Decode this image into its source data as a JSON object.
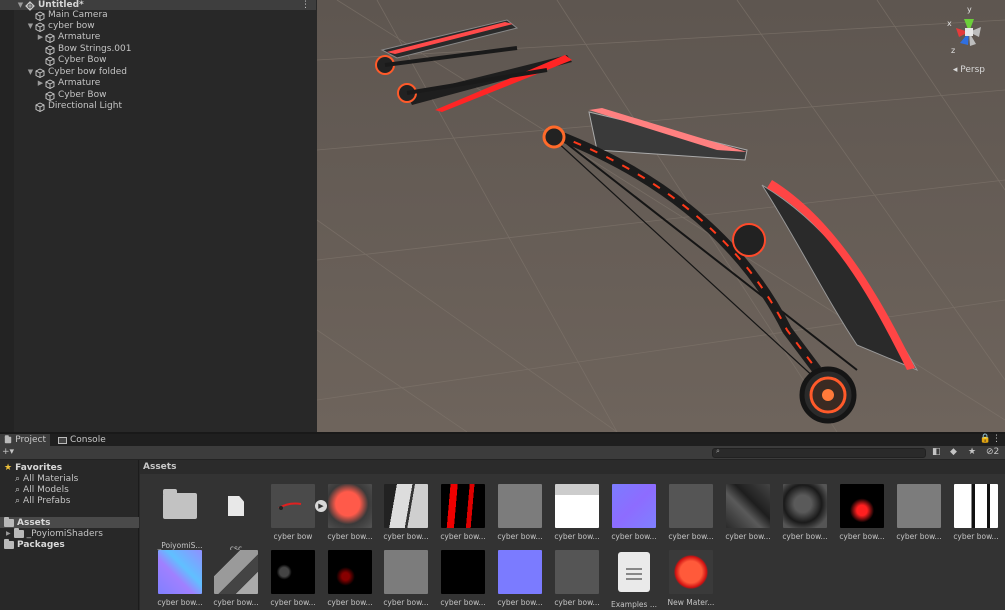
{
  "hierarchy": {
    "items": [
      {
        "label": "Untitled*",
        "depth": 0,
        "arrow": "▼",
        "icon": "scene",
        "bold": true
      },
      {
        "label": "Main Camera",
        "depth": 1,
        "arrow": "",
        "icon": "cube"
      },
      {
        "label": "cyber bow",
        "depth": 1,
        "arrow": "▼",
        "icon": "cube"
      },
      {
        "label": "Armature",
        "depth": 2,
        "arrow": "▶",
        "icon": "cube"
      },
      {
        "label": "Bow Strings.001",
        "depth": 2,
        "arrow": "",
        "icon": "cube"
      },
      {
        "label": "Cyber Bow",
        "depth": 2,
        "arrow": "",
        "icon": "cube"
      },
      {
        "label": "Cyber bow folded",
        "depth": 1,
        "arrow": "▼",
        "icon": "cube"
      },
      {
        "label": "Armature",
        "depth": 2,
        "arrow": "▶",
        "icon": "cube"
      },
      {
        "label": "Cyber Bow",
        "depth": 2,
        "arrow": "",
        "icon": "cube"
      },
      {
        "label": "Directional Light",
        "depth": 1,
        "arrow": "",
        "icon": "cube"
      }
    ],
    "menu_icon": "⋮"
  },
  "scene": {
    "persp_label": "◂ Persp",
    "gizmo": {
      "x": "x",
      "y": "y",
      "z": "z"
    },
    "colors": {
      "background": "#6a6058",
      "grid": "#7a7068",
      "accent": "#ff2a2a"
    }
  },
  "tabs": [
    {
      "label": "Project",
      "icon": "folder-icon",
      "active": true
    },
    {
      "label": "Console",
      "icon": "console-icon",
      "active": false
    }
  ],
  "toolbar": {
    "add": "+▾",
    "lock": "🔒",
    "menu": "⋮",
    "hidden_count": "2"
  },
  "project_tree": {
    "favorites": {
      "label": "Favorites",
      "items": [
        "All Materials",
        "All Models",
        "All Prefabs"
      ]
    },
    "assets": {
      "label": "Assets",
      "children": [
        "_PoyiomiShaders"
      ]
    },
    "packages": {
      "label": "Packages"
    }
  },
  "assets_panel": {
    "header": "Assets",
    "items": [
      {
        "label": "_PoiyomiS...",
        "kind": "folder"
      },
      {
        "label": "csc",
        "kind": "file"
      },
      {
        "label": "cyber bow",
        "kind": "model",
        "play": true
      },
      {
        "label": "cyber bow...",
        "kind": "sphere-red"
      },
      {
        "label": "cyber bow...",
        "kind": "tex-bw"
      },
      {
        "label": "cyber bow...",
        "kind": "tex-red"
      },
      {
        "label": "cyber bow...",
        "kind": "gray"
      },
      {
        "label": "cyber bow...",
        "kind": "white"
      },
      {
        "label": "cyber bow...",
        "kind": "normal"
      },
      {
        "label": "cyber bow...",
        "kind": "dark"
      },
      {
        "label": "cyber bow...",
        "kind": "tex-dark"
      },
      {
        "label": "cyber bow...",
        "kind": "sphere-dark"
      },
      {
        "label": "cyber bow...",
        "kind": "tex-glow"
      },
      {
        "label": "cyber bow...",
        "kind": "gray"
      },
      {
        "label": "cyber bow...",
        "kind": "tex-white"
      },
      {
        "label": "cyber bow...",
        "kind": "normal2"
      },
      {
        "label": "cyber bow...",
        "kind": "tex-gray2"
      },
      {
        "label": "cyber bow...",
        "kind": "tex-black"
      },
      {
        "label": "cyber bow...",
        "kind": "tex-blackred"
      },
      {
        "label": "cyber bow...",
        "kind": "gray"
      },
      {
        "label": "cyber bow...",
        "kind": "black"
      },
      {
        "label": "cyber bow...",
        "kind": "blue"
      },
      {
        "label": "cyber bow...",
        "kind": "dark"
      },
      {
        "label": "Examples ...",
        "kind": "doc"
      },
      {
        "label": "New Mater...",
        "kind": "sphere-glow"
      }
    ]
  }
}
